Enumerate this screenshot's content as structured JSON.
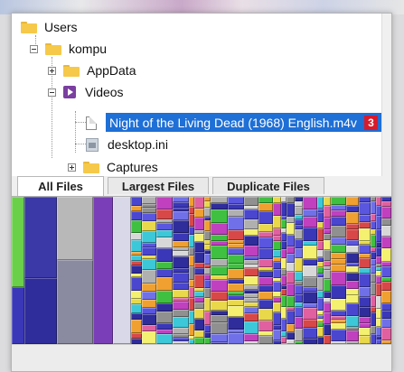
{
  "tree": {
    "items": [
      {
        "label": "Users",
        "icon": "folder-icon"
      },
      {
        "label": "kompu",
        "icon": "folder-icon"
      },
      {
        "label": "AppData",
        "icon": "folder-icon"
      },
      {
        "label": "Videos",
        "icon": "video-folder-icon"
      },
      {
        "label": "Night of the Living Dead (1968) English.m4v",
        "icon": "file-icon",
        "selected": true,
        "badge": "3"
      },
      {
        "label": "desktop.ini",
        "icon": "ini-file-icon"
      },
      {
        "label": "Captures",
        "icon": "folder-icon"
      }
    ]
  },
  "tabs": [
    {
      "label": "All Files",
      "active": true
    },
    {
      "label": "Largest Files",
      "active": false
    },
    {
      "label": "Duplicate Files",
      "active": false
    }
  ],
  "colors": {
    "selection": "#1e6fd6",
    "badge": "#d81b2b",
    "treemap_base": "#2b2a8a",
    "folder": "#f6c94a"
  }
}
